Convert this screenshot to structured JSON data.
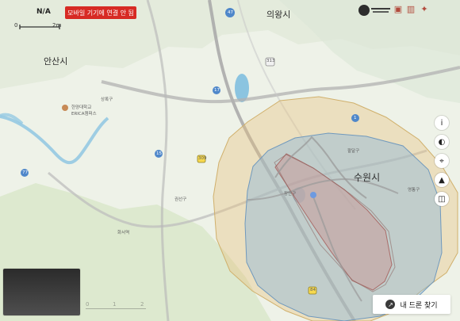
{
  "top_left": {
    "na": "N/A",
    "scale_start": "0",
    "scale_end": "2m",
    "alert": "모바일 기기에 연결 안 됨"
  },
  "map_labels": {
    "uiwang": "의왕시",
    "ansan": "안산시",
    "suwon": "수원시",
    "sangnok": "상록구",
    "jangan": "장안구",
    "paldal": "팔달구",
    "yeongtong": "영통구",
    "hanyang": "한양대학교\nERICA캠퍼스",
    "gwonseon": "권선구",
    "hwaseo": "화서역",
    "road_47": "47",
    "road_42": "42",
    "road_1": "1",
    "road_15": "15",
    "road_17": "17",
    "road_77": "77",
    "road_313": "313",
    "road_84": "84",
    "road_309": "309"
  },
  "controls": {
    "info": "i",
    "erase": "◐",
    "pin": "⌖",
    "nav": "▲",
    "layers": "◫"
  },
  "bottom": {
    "find_drone": "내 드론 찾기",
    "scale_a": "0",
    "scale_b": "1",
    "scale_c": "2"
  }
}
